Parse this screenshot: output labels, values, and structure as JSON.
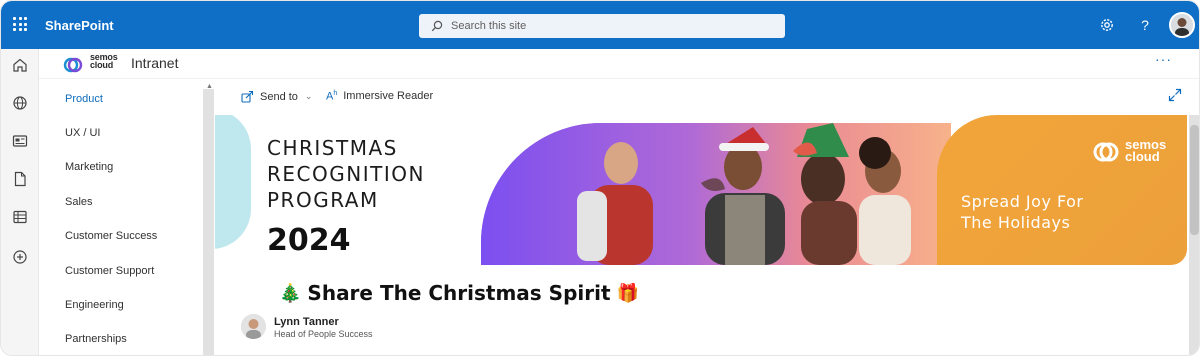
{
  "suite_bar": {
    "app_name": "SharePoint",
    "search_placeholder": "Search this site",
    "icons": [
      "waffle-icon",
      "settings-icon",
      "help-icon",
      "user-avatar"
    ],
    "color": "#0f6cbd"
  },
  "app_bar": {
    "icons": [
      "home-icon",
      "globe-icon",
      "news-icon",
      "file-icon",
      "list-icon",
      "add-icon"
    ]
  },
  "site_header": {
    "logo_text_line1": "semos",
    "logo_text_line2": "cloud",
    "title": "Intranet",
    "more_label": "···"
  },
  "left_nav": {
    "items": [
      {
        "label": "Product",
        "active": true
      },
      {
        "label": "UX / UI",
        "active": false
      },
      {
        "label": "Marketing",
        "active": false
      },
      {
        "label": "Sales",
        "active": false
      },
      {
        "label": "Customer Success",
        "active": false
      },
      {
        "label": "Customer Support",
        "active": false
      },
      {
        "label": "Engineering",
        "active": false
      },
      {
        "label": "Partnerships",
        "active": false
      }
    ]
  },
  "command_bar": {
    "send_to": "Send to",
    "immersive_reader": "Immersive Reader"
  },
  "banner": {
    "title_line1": "CHRISTMAS",
    "title_line2": "RECOGNITION",
    "title_line3": "PROGRAM",
    "year": "2024",
    "logo_line1": "semos",
    "logo_line2": "cloud",
    "tagline_line1": "Spread Joy For",
    "tagline_line2": "The Holidays",
    "accent_orange": "#f0a33a",
    "accent_purple": "#8a5cf0"
  },
  "article": {
    "headline_prefix_emoji": "🎄",
    "headline": "Share The Christmas Spirit",
    "headline_suffix_emoji": "🎁",
    "author_name": "Lynn Tanner",
    "author_role": "Head of People Success"
  }
}
